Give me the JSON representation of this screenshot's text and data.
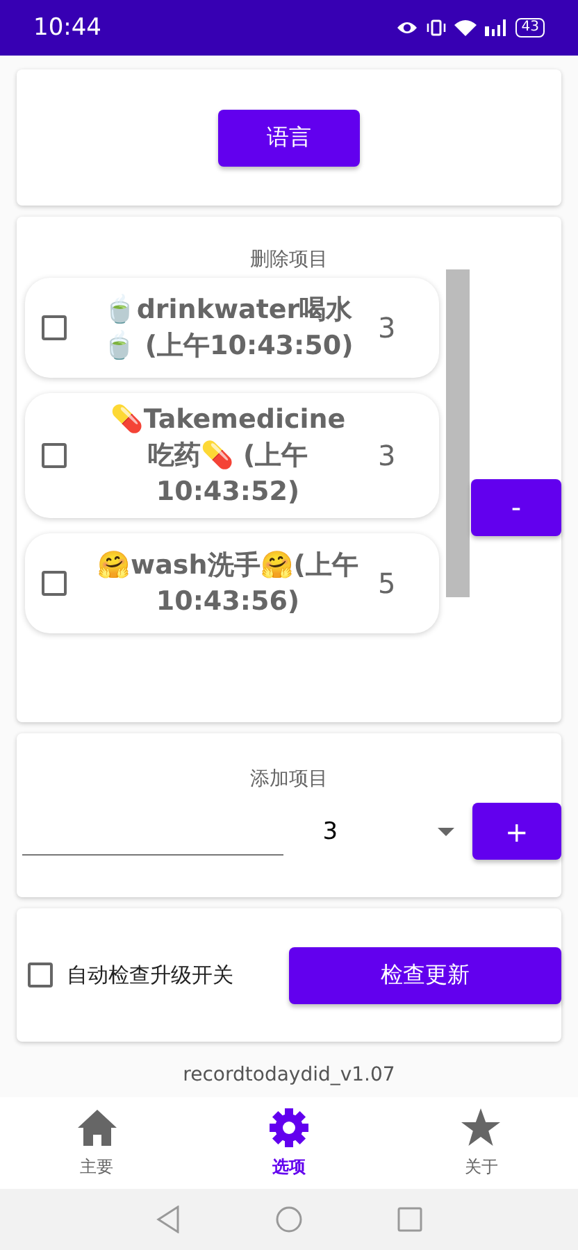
{
  "status_bar": {
    "time": "10:44",
    "battery": "43"
  },
  "language_button": "语言",
  "delete_section": {
    "title": "删除项目",
    "items": [
      {
        "label": "🍵drinkwater喝水🍵 (上午10:43:50)",
        "count": "3",
        "checked": false
      },
      {
        "label": "💊Takemedicine吃药💊 (上午10:43:52)",
        "count": "3",
        "checked": false
      },
      {
        "label": "🤗wash洗手🤗(上午10:43:56)",
        "count": "5",
        "checked": false
      }
    ],
    "remove_button": "-"
  },
  "add_section": {
    "title": "添加项目",
    "spinner_value": "3",
    "add_button": "+"
  },
  "update_section": {
    "auto_check": {
      "label": "自动检查升级开关",
      "checked": false
    },
    "check_button": "检查更新"
  },
  "version": "recordtodaydid_v1.07",
  "bottom_nav": [
    {
      "label": "主要",
      "selected": false
    },
    {
      "label": "选项",
      "selected": true
    },
    {
      "label": "关于",
      "selected": false
    }
  ]
}
